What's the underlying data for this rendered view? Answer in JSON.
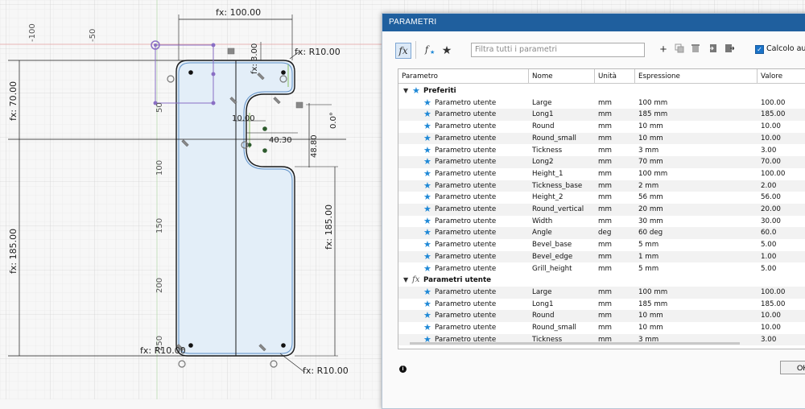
{
  "sketch": {
    "ruler_top": [
      "-100",
      "-50"
    ],
    "ruler_left": [
      "50",
      "100",
      "150",
      "200",
      "250"
    ],
    "dimensions": {
      "width_top": "fx: 100.00",
      "radius_top_right": "fx: R10.00",
      "small_top": "fx: 3.00",
      "height_70": "fx: 70.00",
      "height_185_left": "fx: 185.00",
      "height_185_right": "fx: 185.00",
      "dim_10": "10.00",
      "dim_40_30": "40.30",
      "dim_48_80": "48.80",
      "angle": "0.0°",
      "radius_bottom_left": "fx: R10.00",
      "radius_bottom_right": "fx: R10.00"
    }
  },
  "dialog": {
    "title": "PARAMETRI",
    "toolbar": {
      "fx_label": "fx",
      "filter_placeholder": "Filtra tutti i parametri",
      "auto_calc_label": "Calcolo autom"
    },
    "columns": [
      "Parametro",
      "Nome",
      "Unità",
      "Espressione",
      "Valore"
    ],
    "groups": [
      {
        "label": "Preferiti",
        "icon": "star-icon",
        "rows": [
          {
            "param": "Parametro utente",
            "name": "Large",
            "unit": "mm",
            "expr": "100 mm",
            "value": "100.00"
          },
          {
            "param": "Parametro utente",
            "name": "Long1",
            "unit": "mm",
            "expr": "185 mm",
            "value": "185.00"
          },
          {
            "param": "Parametro utente",
            "name": "Round",
            "unit": "mm",
            "expr": "10 mm",
            "value": "10.00"
          },
          {
            "param": "Parametro utente",
            "name": "Round_small",
            "unit": "mm",
            "expr": "10 mm",
            "value": "10.00"
          },
          {
            "param": "Parametro utente",
            "name": "Tickness",
            "unit": "mm",
            "expr": "3 mm",
            "value": "3.00"
          },
          {
            "param": "Parametro utente",
            "name": "Long2",
            "unit": "mm",
            "expr": "70 mm",
            "value": "70.00"
          },
          {
            "param": "Parametro utente",
            "name": "Height_1",
            "unit": "mm",
            "expr": "100 mm",
            "value": "100.00"
          },
          {
            "param": "Parametro utente",
            "name": "Tickness_base",
            "unit": "mm",
            "expr": "2 mm",
            "value": "2.00"
          },
          {
            "param": "Parametro utente",
            "name": "Height_2",
            "unit": "mm",
            "expr": "56 mm",
            "value": "56.00"
          },
          {
            "param": "Parametro utente",
            "name": "Round_vertical",
            "unit": "mm",
            "expr": "20 mm",
            "value": "20.00"
          },
          {
            "param": "Parametro utente",
            "name": "Width",
            "unit": "mm",
            "expr": "30 mm",
            "value": "30.00"
          },
          {
            "param": "Parametro utente",
            "name": "Angle",
            "unit": "deg",
            "expr": "60 deg",
            "value": "60.0"
          },
          {
            "param": "Parametro utente",
            "name": "Bevel_base",
            "unit": "mm",
            "expr": "5 mm",
            "value": "5.00"
          },
          {
            "param": "Parametro utente",
            "name": "Bevel_edge",
            "unit": "mm",
            "expr": "1 mm",
            "value": "1.00"
          },
          {
            "param": "Parametro utente",
            "name": "Grill_height",
            "unit": "mm",
            "expr": "5 mm",
            "value": "5.00"
          }
        ]
      },
      {
        "label": "Parametri utente",
        "icon": "fx-icon",
        "rows": [
          {
            "param": "Parametro utente",
            "name": "Large",
            "unit": "mm",
            "expr": "100 mm",
            "value": "100.00"
          },
          {
            "param": "Parametro utente",
            "name": "Long1",
            "unit": "mm",
            "expr": "185 mm",
            "value": "185.00"
          },
          {
            "param": "Parametro utente",
            "name": "Round",
            "unit": "mm",
            "expr": "10 mm",
            "value": "10.00"
          },
          {
            "param": "Parametro utente",
            "name": "Round_small",
            "unit": "mm",
            "expr": "10 mm",
            "value": "10.00"
          },
          {
            "param": "Parametro utente",
            "name": "Tickness",
            "unit": "mm",
            "expr": "3 mm",
            "value": "3.00"
          }
        ]
      }
    ],
    "ok_label": "OK"
  },
  "colors": {
    "title_bar": "#1f5f9e",
    "star": "#1e88d6",
    "sketch_fill": "#e3eef8",
    "constraint_purple": "#8a6fc4"
  }
}
